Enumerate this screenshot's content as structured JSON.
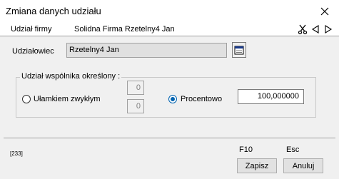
{
  "window": {
    "title": "Zmiana danych udziału"
  },
  "header": {
    "company_label": "Udział firmy",
    "company_value": "Solidna Firma Rzetelny4 Jan",
    "icons": [
      "scissors-icon",
      "prev-arrow-icon",
      "next-arrow-icon"
    ]
  },
  "shareholder": {
    "label": "Udziałowiec",
    "value": "Rzetelny4 Jan",
    "lookup_icon": "calendar-lookup-icon"
  },
  "share_group": {
    "title": "Udział wspólnika określony :",
    "fraction_option": {
      "label": "Ułamkiem zwykłym",
      "selected": false,
      "numerator": "0",
      "denominator": "0"
    },
    "percent_option": {
      "label": "Procentowo",
      "selected": true,
      "value": "100,000000"
    }
  },
  "footer": {
    "code": "[233]",
    "save_key": "F10",
    "cancel_key": "Esc",
    "save_label": "Zapisz",
    "cancel_label": "Anuluj"
  },
  "colors": {
    "accent": "#0063b1",
    "titlebar_bg": "#ffffff",
    "window_bg": "#f0f0f0",
    "readonly_field_bg": "#e0e0e0"
  }
}
